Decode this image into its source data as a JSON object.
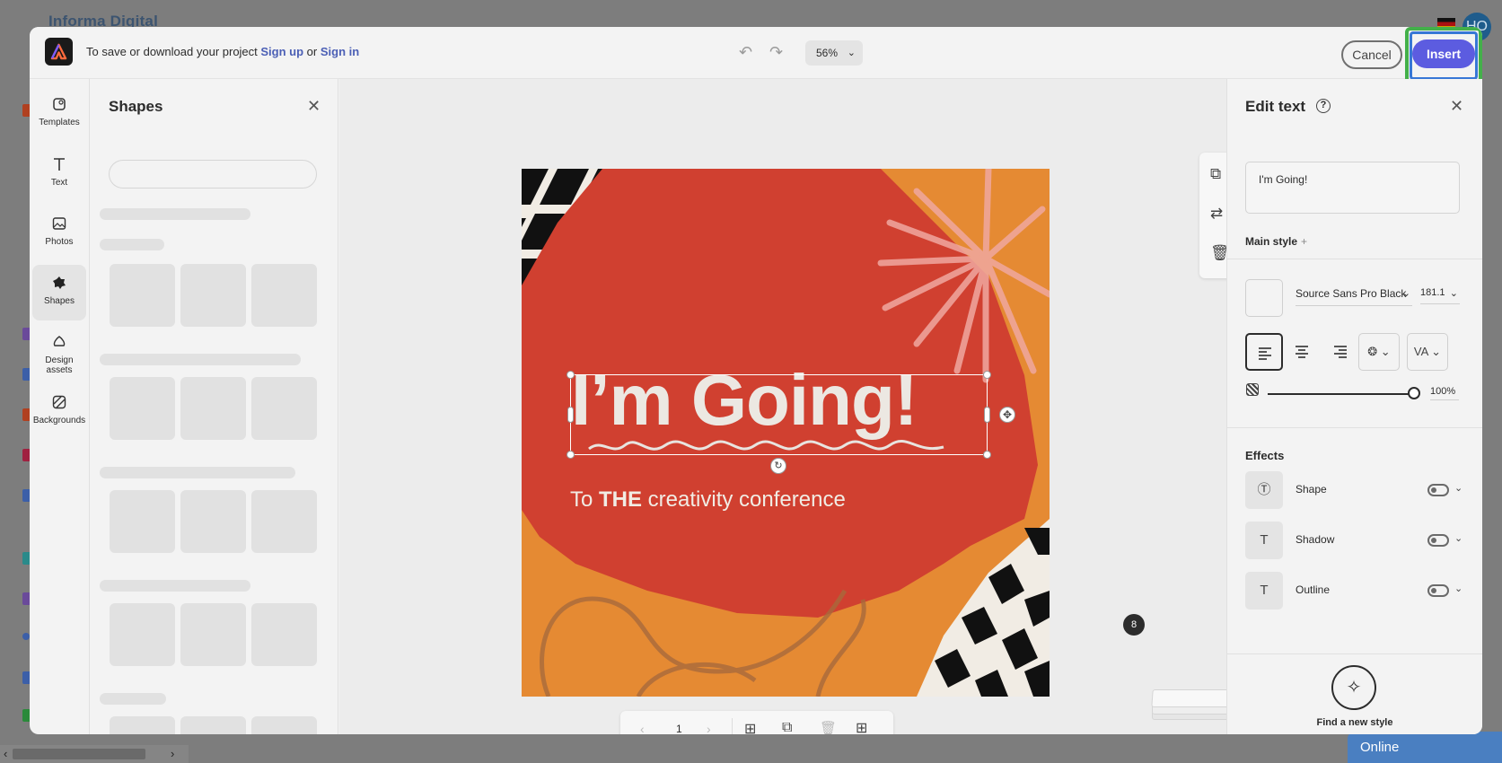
{
  "background": {
    "logo_text": "Informa Digital",
    "avatar_initials": "HO",
    "status_pill": "Online"
  },
  "topbar": {
    "save_prefix": "To save or download your project ",
    "sign_up": "Sign up",
    "or": " or ",
    "sign_in": "Sign in",
    "zoom": "56%",
    "cancel_label": "Cancel",
    "insert_label": "Insert"
  },
  "rail": {
    "items": [
      {
        "label": "Templates",
        "icon": "templates-icon"
      },
      {
        "label": "Text",
        "icon": "text-icon"
      },
      {
        "label": "Photos",
        "icon": "photos-icon"
      },
      {
        "label": "Shapes",
        "icon": "shapes-icon",
        "active": true
      },
      {
        "label": "Design assets",
        "icon": "design-assets-icon"
      },
      {
        "label": "Backgrounds",
        "icon": "backgrounds-icon"
      }
    ]
  },
  "shapes_panel": {
    "title": "Shapes",
    "search_placeholder": ""
  },
  "artboard": {
    "headline": "I’m Going!",
    "subtitle_pre": "To ",
    "subtitle_bold": "THE",
    "subtitle_post": " creativity conference"
  },
  "page_nav": {
    "page_number": "1",
    "page_count_badge": "8"
  },
  "edit_panel": {
    "title": "Edit text",
    "text_value": "I'm Going!",
    "main_style_label": "Main style",
    "main_style_plus": "+",
    "font_name": "Source Sans Pro Black",
    "font_size": "181.1",
    "opacity": "100%",
    "effects_title": "Effects",
    "effects": [
      {
        "label": "Shape",
        "icon": "text-shape-icon"
      },
      {
        "label": "Shadow",
        "icon": "shadow-icon"
      },
      {
        "label": "Outline",
        "icon": "outline-icon"
      }
    ],
    "find_style_label": "Find a new style"
  },
  "colors": {
    "accent": "#5c5ce0",
    "link": "#4b5fb5",
    "artboard_red": "#d04030",
    "artboard_orange": "#e58a33",
    "highlight_green": "#43b04a",
    "highlight_blue": "#3777d6"
  }
}
